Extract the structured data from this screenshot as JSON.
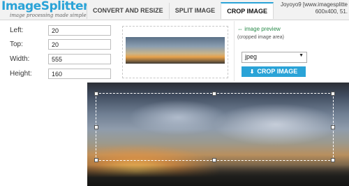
{
  "logo": {
    "title": "ImageSplitter",
    "tagline": "image processing made simple"
  },
  "tabs": [
    {
      "label": "CONVERT AND RESIZE",
      "active": false
    },
    {
      "label": "SPLIT IMAGE",
      "active": false
    },
    {
      "label": "CROP IMAGE",
      "active": true
    }
  ],
  "header_info": {
    "user": "Joyoyo9 [www.imagesplitte",
    "dimensions": "600x400, 51."
  },
  "form": {
    "left": {
      "label": "Left:",
      "value": "20"
    },
    "top": {
      "label": "Top:",
      "value": "20"
    },
    "width": {
      "label": "Width:",
      "value": "555"
    },
    "height": {
      "label": "Height:",
      "value": "160"
    }
  },
  "preview": {
    "link": "⇔ image preview",
    "caption": "(cropped image area)"
  },
  "format_select": {
    "value": "jpeg",
    "arrow_icon": "caret-down"
  },
  "crop_button": {
    "label": "CROP IMAGE",
    "icon": "download-arrow"
  },
  "colors": {
    "accent": "#2aa3d7",
    "link_green": "#2a8a4a"
  }
}
